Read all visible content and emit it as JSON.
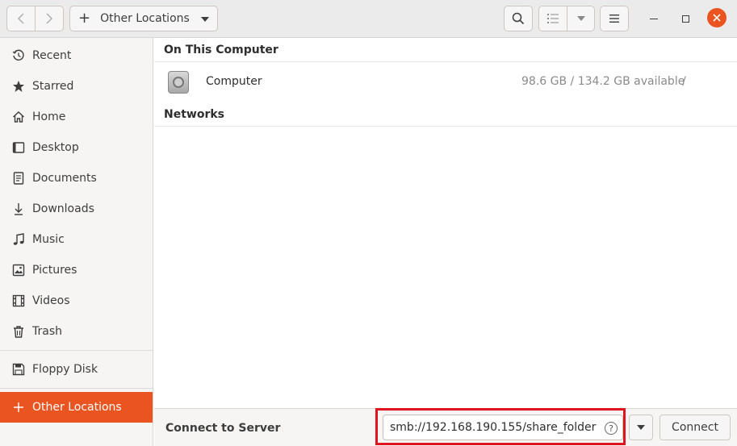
{
  "header": {
    "path_label": "Other Locations"
  },
  "sidebar": {
    "items": [
      {
        "label": "Recent",
        "icon": "clock-icon"
      },
      {
        "label": "Starred",
        "icon": "star-icon"
      },
      {
        "label": "Home",
        "icon": "home-icon"
      },
      {
        "label": "Desktop",
        "icon": "desktop-icon"
      },
      {
        "label": "Documents",
        "icon": "document-icon"
      },
      {
        "label": "Downloads",
        "icon": "download-icon"
      },
      {
        "label": "Music",
        "icon": "music-icon"
      },
      {
        "label": "Pictures",
        "icon": "picture-icon"
      },
      {
        "label": "Videos",
        "icon": "video-icon"
      },
      {
        "label": "Trash",
        "icon": "trash-icon"
      },
      {
        "label": "Floppy Disk",
        "icon": "floppy-disk-icon"
      },
      {
        "label": "Other Locations",
        "icon": "plus-icon"
      }
    ]
  },
  "main": {
    "on_this_computer": "On This Computer",
    "computer": {
      "name": "Computer",
      "space": "98.6 GB / 134.2 GB available",
      "mount": "/"
    },
    "networks": "Networks"
  },
  "bottombar": {
    "connect_label": "Connect to Server",
    "server_address": "smb://192.168.190.155/share_folder",
    "connect_button": "Connect",
    "help_glyph": "?"
  },
  "colors": {
    "accent": "#e95420",
    "highlight_box": "#e0141e"
  }
}
